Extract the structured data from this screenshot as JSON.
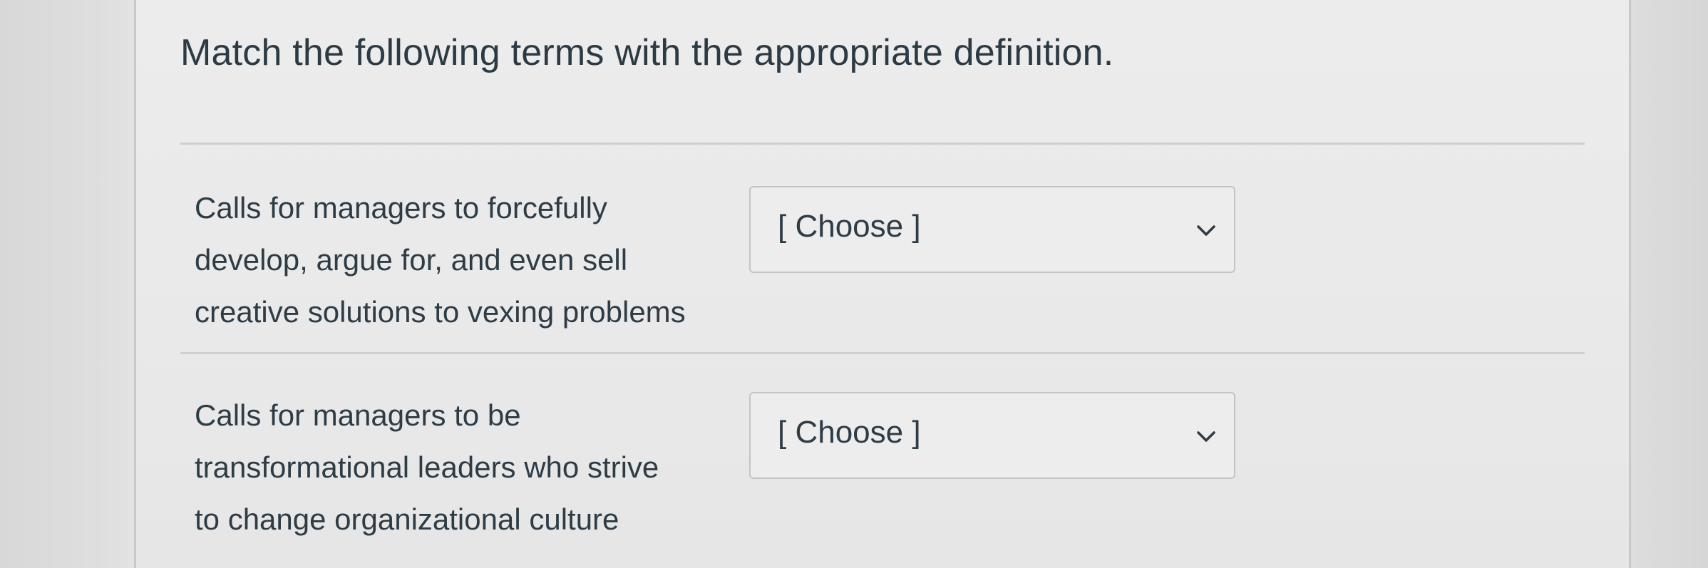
{
  "question": {
    "prompt": "Match the following terms with the appropriate definition."
  },
  "answers": [
    {
      "term_lines": [
        "Calls for managers to forcefully",
        "develop, argue for, and even sell",
        "creative solutions to vexing problems"
      ],
      "selected": "[ Choose ]"
    },
    {
      "term_lines": [
        "Calls for managers to be",
        "transformational leaders who strive",
        "to change organizational culture"
      ],
      "selected": "[ Choose ]"
    }
  ],
  "icons": {
    "dropdown": "chevron-down-icon"
  },
  "colors": {
    "text": "#2d3b45",
    "card_background": "#ebebeb",
    "border": "#c4c4c4"
  }
}
